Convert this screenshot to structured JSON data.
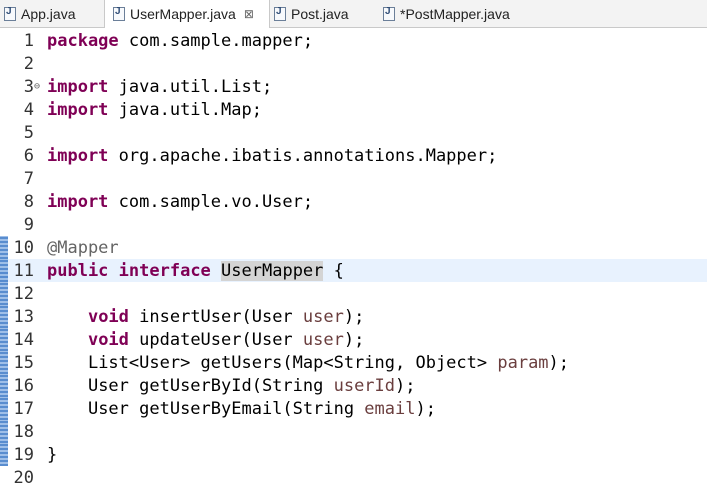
{
  "tabs": [
    {
      "label": "App.java",
      "active": false
    },
    {
      "label": "UserMapper.java",
      "active": true,
      "close": "⊠"
    },
    {
      "label": "Post.java",
      "active": false
    },
    {
      "label": "*PostMapper.java",
      "active": false
    }
  ],
  "editor": {
    "line_numbers": [
      "1",
      "2",
      "3",
      "4",
      "5",
      "6",
      "7",
      "8",
      "9",
      "10",
      "11",
      "12",
      "13",
      "14",
      "15",
      "16",
      "17",
      "18",
      "19",
      "20"
    ],
    "fold_marker": "⊖",
    "tokens": {
      "package": "package",
      "pkg_name": " com.sample.mapper;",
      "import": "import",
      "imp1": " java.util.List;",
      "imp2": " java.util.Map;",
      "imp3": " org.apache.ibatis.annotations.Mapper;",
      "imp4": " com.sample.vo.User;",
      "annotation": "@Mapper",
      "public": "public",
      "interface": "interface",
      "class_name": "UserMapper",
      "open_brace": " {",
      "void": "void",
      "m1": " insertUser(User ",
      "m1p": "user",
      "m1e": ");",
      "m2": " updateUser(User ",
      "m2p": "user",
      "m2e": ");",
      "m3": "List<User> getUsers(Map<String, Object> ",
      "m3p": "param",
      "m3e": ");",
      "m4": "User getUserById(String ",
      "m4p": "userId",
      "m4e": ");",
      "m5": "User getUserByEmail(String ",
      "m5p": "email",
      "m5e": ");",
      "close_brace": "}",
      "indent": "    ",
      "space": " "
    }
  },
  "colors": {
    "keyword": "#7f0055",
    "annotation": "#646464",
    "parameter": "#6a3e3e",
    "current_line": "#e8f2fe"
  }
}
